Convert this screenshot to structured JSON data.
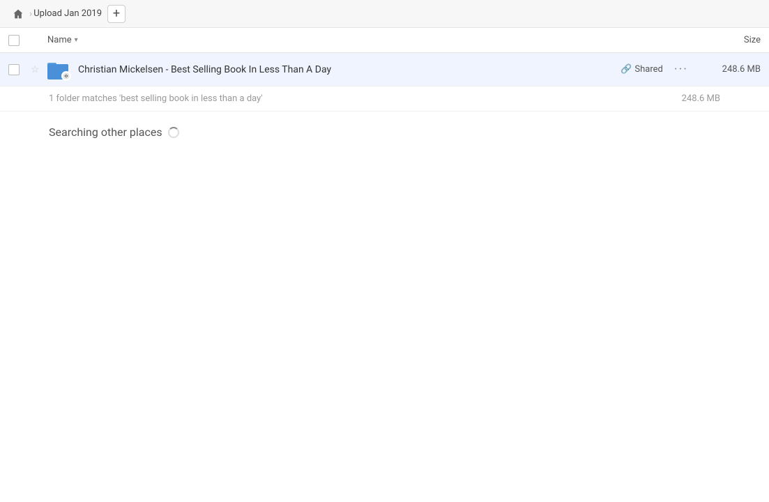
{
  "header": {
    "home_icon_label": "home",
    "breadcrumb_separator": "›",
    "breadcrumb_title": "Upload Jan 2019",
    "add_button_label": "+"
  },
  "columns": {
    "name_label": "Name",
    "size_label": "Size"
  },
  "file_row": {
    "name": "Christian Mickelsen - Best Selling Book In Less Than A Day",
    "shared_label": "Shared",
    "size": "248.6 MB",
    "more_icon": "···"
  },
  "match_info": {
    "text": "1 folder matches 'best selling book in less than a day'",
    "size": "248.6 MB"
  },
  "searching_section": {
    "label": "Searching other places"
  }
}
